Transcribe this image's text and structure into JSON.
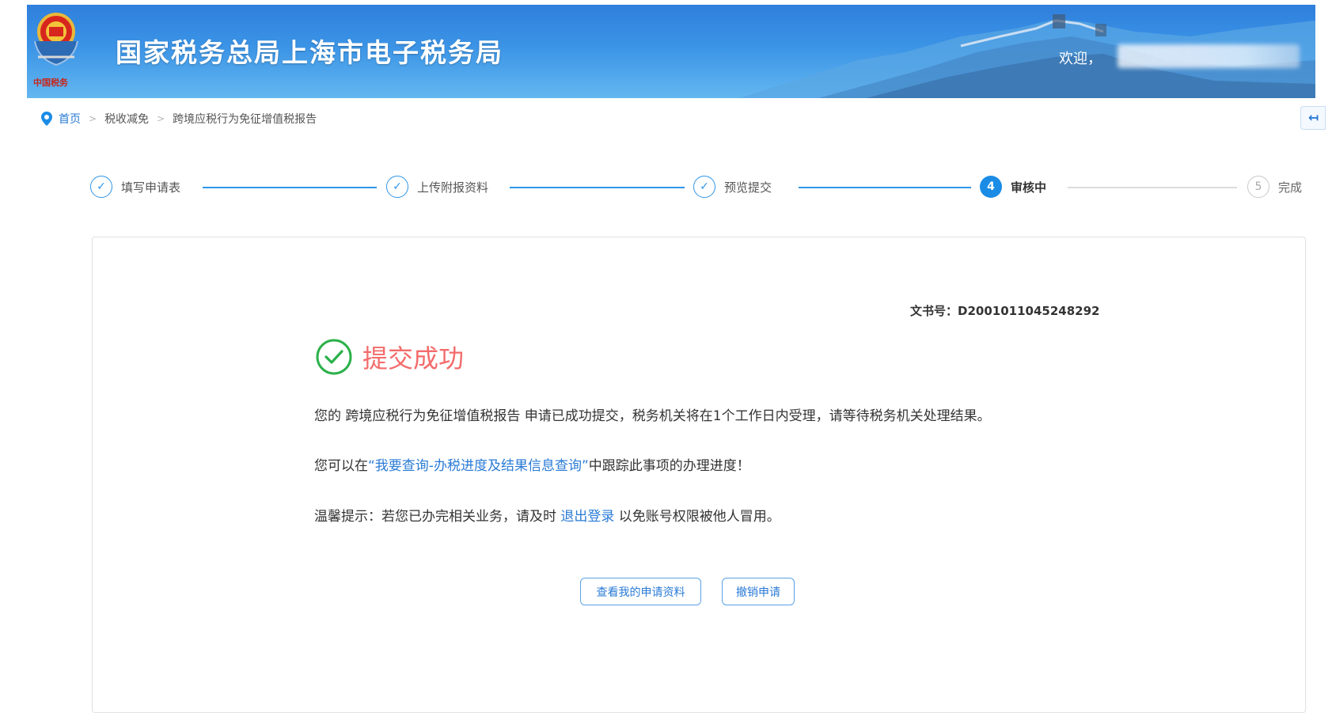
{
  "header": {
    "site_title": "国家税务总局上海市电子税务局",
    "welcome_text": "欢迎，",
    "emblem_icon": "national-emblem-icon",
    "brand_color": "#2f7fdc"
  },
  "breadcrumb": {
    "icon": "location-pin-icon",
    "items": [
      "首页",
      "税收减免",
      "跨境应税行为免征增值税报告"
    ],
    "separator": ">"
  },
  "steps": [
    {
      "label": "填写申请表",
      "state": "done",
      "marker": "✓"
    },
    {
      "label": "上传附报资料",
      "state": "done",
      "marker": "✓"
    },
    {
      "label": "预览提交",
      "state": "done",
      "marker": "✓"
    },
    {
      "label": "审核中",
      "state": "active",
      "marker": "4"
    },
    {
      "label": "完成",
      "state": "todo",
      "marker": "5"
    }
  ],
  "result": {
    "doc_number_label": "文书号：",
    "doc_number": "D2001011045248292",
    "title": "提交成功",
    "title_color": "#f46b6b",
    "message_prefix": "您的 ",
    "report_name": "跨境应税行为免征增值税报告",
    "message_suffix": " 申请已成功提交，税务机关将在1个工作日内受理，请等待税务机关处理结果。",
    "track_prefix": "您可以在",
    "track_link": "“我要查询-办税进度及结果信息查询”",
    "track_suffix": "中跟踪此事项的办理进度！",
    "tip_prefix": "温馨提示：若您已办完相关业务，请及时 ",
    "logout_link": "退出登录",
    "tip_suffix": " 以免账号权限被他人冒用。"
  },
  "buttons": {
    "view_application": "查看我的申请资料",
    "revoke_application": "撤销申请"
  },
  "colors": {
    "accent": "#1a8ce6",
    "link": "#2a7bd6",
    "success_green": "#2bb14a"
  }
}
